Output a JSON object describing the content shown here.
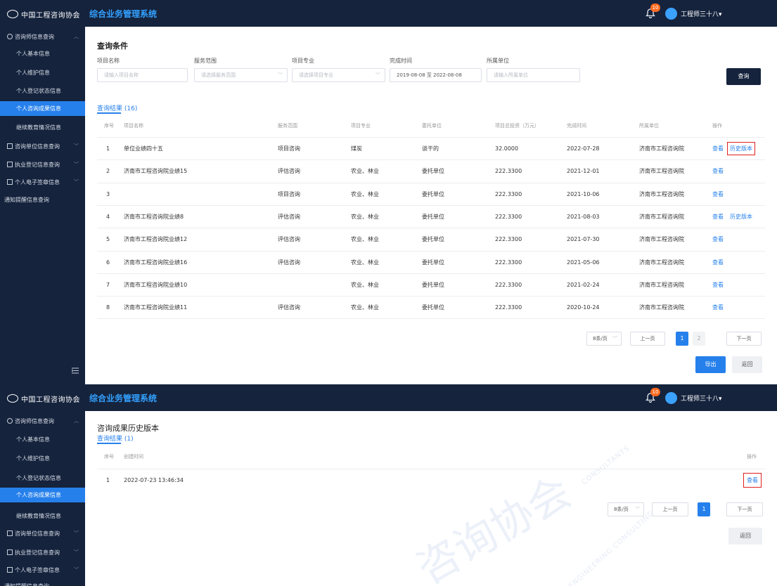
{
  "app": {
    "logo_text": "中国工程咨询协会",
    "system_title": "综合业务管理系统",
    "notification_count": "10",
    "user_name": "工程师三十八▾"
  },
  "sidebar": {
    "groups": [
      {
        "label": "咨询师信息查询",
        "icon": "clock-icon",
        "expanded": true,
        "items": [
          "个人基本信息",
          "个人维护信息",
          "个人登记状态信息",
          "个人咨询成果信息",
          "继续教育情况信息"
        ],
        "active_item": "个人咨询成果信息"
      },
      {
        "label": "咨询单位信息查询",
        "icon": "document-icon"
      },
      {
        "label": "执业登记信息查询",
        "icon": "document-icon"
      },
      {
        "label": "个人电子签章信息",
        "icon": "document-icon"
      },
      {
        "label": "通知提醒信息查询"
      }
    ]
  },
  "screenA": {
    "query_title": "查询条件",
    "filters": [
      {
        "label": "项目名称",
        "placeholder": "请输入项目名称",
        "type": "text"
      },
      {
        "label": "服务范围",
        "placeholder": "请选择服务范围",
        "type": "select"
      },
      {
        "label": "项目专业",
        "placeholder": "请选择项目专业",
        "type": "select"
      },
      {
        "label": "完成时间",
        "value": "2019-08-08  至  2022-08-08",
        "type": "date-range"
      },
      {
        "label": "所属单位",
        "placeholder": "请输入所属单位",
        "type": "text"
      }
    ],
    "search_button": "查询",
    "result_tab": "查询结果 (16)",
    "columns": [
      "序号",
      "项目名称",
      "服务范围",
      "项目专业",
      "委托单位",
      "项目总投资（万元）",
      "完成时间",
      "所属单位",
      "操作"
    ],
    "rows": [
      {
        "no": "1",
        "name": "单位业绩四十五",
        "scope": "项目咨询",
        "major": "煤炭",
        "client": "谈干的",
        "investment": "32.0000",
        "date": "2022-07-28",
        "unit": "济南市工程咨询院",
        "actions": [
          "查看",
          "历史版本"
        ]
      },
      {
        "no": "2",
        "name": "济南市工程咨询院业绩15",
        "scope": "评估咨询",
        "major": "农业、林业",
        "client": "委托单位",
        "investment": "222.3300",
        "date": "2021-12-01",
        "unit": "济南市工程咨询院",
        "actions": [
          "查看"
        ]
      },
      {
        "no": "3",
        "name": "",
        "scope": "项目咨询",
        "major": "农业、林业",
        "client": "委托单位",
        "investment": "222.3300",
        "date": "2021-10-06",
        "unit": "济南市工程咨询院",
        "actions": [
          "查看"
        ]
      },
      {
        "no": "4",
        "name": "济南市工程咨询院业绩8",
        "scope": "评估咨询",
        "major": "农业、林业",
        "client": "委托单位",
        "investment": "222.3300",
        "date": "2021-08-03",
        "unit": "济南市工程咨询院",
        "actions": [
          "查看",
          "历史版本"
        ]
      },
      {
        "no": "5",
        "name": "济南市工程咨询院业绩12",
        "scope": "评估咨询",
        "major": "农业、林业",
        "client": "委托单位",
        "investment": "222.3300",
        "date": "2021-07-30",
        "unit": "济南市工程咨询院",
        "actions": [
          "查看"
        ]
      },
      {
        "no": "6",
        "name": "济南市工程咨询院业绩16",
        "scope": "评估咨询",
        "major": "农业、林业",
        "client": "委托单位",
        "investment": "222.3300",
        "date": "2021-05-06",
        "unit": "济南市工程咨询院",
        "actions": [
          "查看"
        ]
      },
      {
        "no": "7",
        "name": "济南市工程咨询院业绩10",
        "scope": "",
        "major": "农业、林业",
        "client": "委托单位",
        "investment": "222.3300",
        "date": "2021-02-24",
        "unit": "济南市工程咨询院",
        "actions": [
          "查看"
        ]
      },
      {
        "no": "8",
        "name": "济南市工程咨询院业绩11",
        "scope": "评估咨询",
        "major": "农业、林业",
        "client": "委托单位",
        "investment": "222.3300",
        "date": "2020-10-24",
        "unit": "济南市工程咨询院",
        "actions": [
          "查看"
        ]
      }
    ],
    "pagination": {
      "page_size": "8条/页",
      "prev": "上一页",
      "pages": [
        "1",
        "2"
      ],
      "current": "1",
      "next": "下一页"
    },
    "export_button": "导出",
    "back_button": "返回"
  },
  "screenB": {
    "title": "咨询成果历史版本",
    "result_tab": "查询结果 (1)",
    "columns": [
      "序号",
      "创建时间",
      "操作"
    ],
    "rows": [
      {
        "no": "1",
        "created": "2022-07-23 13:46:34",
        "action": "查看"
      }
    ],
    "pagination": {
      "page_size": "8条/页",
      "prev": "上一页",
      "pages": [
        "1"
      ],
      "current": "1",
      "next": "下一页"
    },
    "back_button": "返回",
    "watermark": "咨询协会",
    "watermark_latin_1": "CONSULTANTS",
    "watermark_latin_2": "ENGINEERING CONSULTING"
  },
  "colors": {
    "nav_bg": "#15233d",
    "accent": "#2680eb",
    "title_blue": "#33a1ff",
    "highlight": "#e02020",
    "badge": "#ff6a1f"
  }
}
